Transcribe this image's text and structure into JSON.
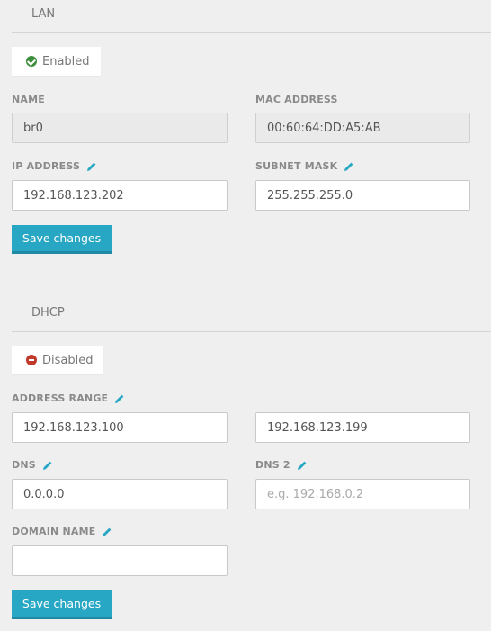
{
  "lan": {
    "title": "LAN",
    "status": "Enabled",
    "name_label": "NAME",
    "name_value": "br0",
    "mac_label": "MAC ADDRESS",
    "mac_value": "00:60:64:DD:A5:AB",
    "ip_label": "IP ADDRESS",
    "ip_value": "192.168.123.202",
    "subnet_label": "SUBNET MASK",
    "subnet_value": "255.255.255.0",
    "save_label": "Save changes"
  },
  "dhcp": {
    "title": "DHCP",
    "status": "Disabled",
    "range_label": "ADDRESS RANGE",
    "range_start": "192.168.123.100",
    "range_end": "192.168.123.199",
    "dns_label": "DNS",
    "dns_value": "0.0.0.0",
    "dns2_label": "DNS 2",
    "dns2_placeholder": "e.g. 192.168.0.2",
    "domain_label": "DOMAIN NAME",
    "domain_value": "",
    "save_label": "Save changes"
  },
  "colors": {
    "accent": "#27a7c4",
    "enabled": "#3d8f3d",
    "disabled": "#c0392b"
  },
  "icons": [
    "check-circle-icon",
    "minus-circle-icon",
    "pencil-icon"
  ]
}
